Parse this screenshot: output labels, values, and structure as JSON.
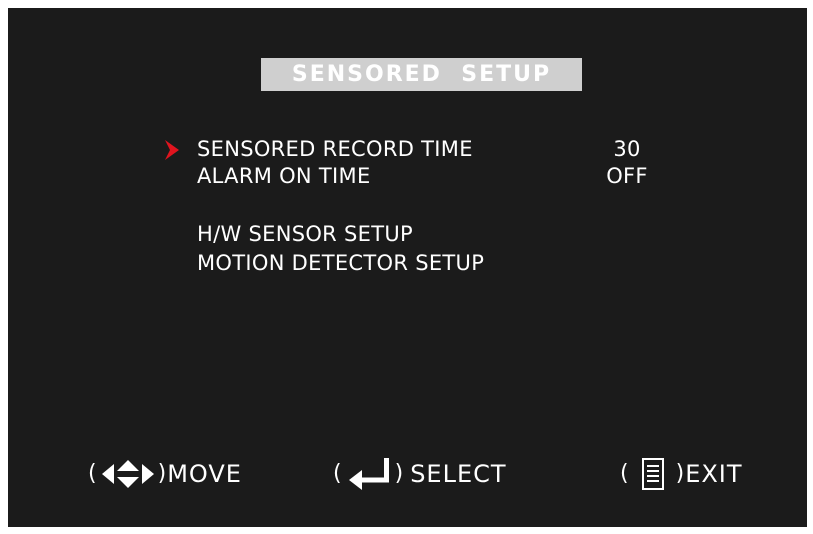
{
  "title": "SENSORED  SETUP",
  "menu": {
    "items": [
      {
        "label": "SENSORED RECORD TIME",
        "value": "30",
        "selected": true
      },
      {
        "label": "ALARM ON TIME",
        "value": "OFF",
        "selected": false
      },
      {
        "label": "H/W SENSOR SETUP",
        "value": "",
        "selected": false
      },
      {
        "label": "MOTION DETECTOR SETUP",
        "value": "",
        "selected": false
      }
    ]
  },
  "footer": {
    "move": {
      "open": "(",
      "close": ")",
      "label": "MOVE",
      "icon": "four-way-arrows-icon"
    },
    "select": {
      "open": "(",
      "close": ")",
      "label": "SELECT",
      "icon": "enter-arrow-icon"
    },
    "exit": {
      "open": "(",
      "close": ")",
      "label": "EXIT",
      "icon": "menu-icon"
    }
  },
  "colors": {
    "background": "#1b1b1b",
    "title_bar": "#cfcfcf",
    "text": "#ffffff",
    "cursor": "#e0141e"
  }
}
